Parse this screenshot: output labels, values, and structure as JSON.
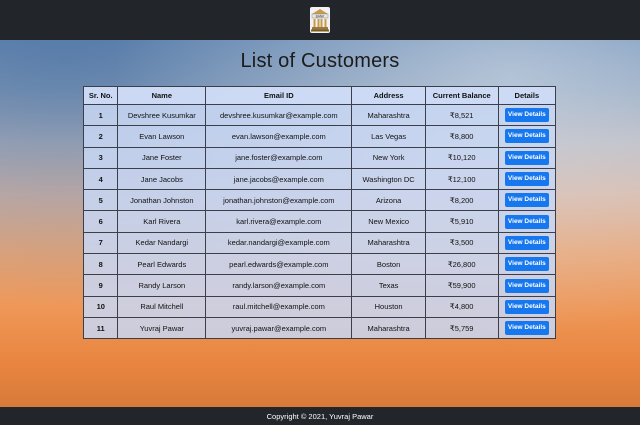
{
  "header": {
    "logo_text": "BANK"
  },
  "page": {
    "title": "List of Customers"
  },
  "table": {
    "headers": [
      "Sr. No.",
      "Name",
      "Email ID",
      "Address",
      "Current Balance",
      "Details"
    ],
    "button_label": "View Details",
    "rows": [
      {
        "sr": "1",
        "name": "Devshree Kusumkar",
        "email": "devshree.kusumkar@example.com",
        "address": "Maharashtra",
        "balance": "₹8,521"
      },
      {
        "sr": "2",
        "name": "Evan Lawson",
        "email": "evan.lawson@example.com",
        "address": "Las Vegas",
        "balance": "₹8,800"
      },
      {
        "sr": "3",
        "name": "Jane Foster",
        "email": "jane.foster@example.com",
        "address": "New York",
        "balance": "₹10,120"
      },
      {
        "sr": "4",
        "name": "Jane Jacobs",
        "email": "jane.jacobs@example.com",
        "address": "Washington DC",
        "balance": "₹12,100"
      },
      {
        "sr": "5",
        "name": "Jonathan Johnston",
        "email": "jonathan.johnston@example.com",
        "address": "Arizona",
        "balance": "₹8,200"
      },
      {
        "sr": "6",
        "name": "Karl Rivera",
        "email": "karl.rivera@example.com",
        "address": "New Mexico",
        "balance": "₹5,910"
      },
      {
        "sr": "7",
        "name": "Kedar Nandargi",
        "email": "kedar.nandargi@example.com",
        "address": "Maharashtra",
        "balance": "₹3,500"
      },
      {
        "sr": "8",
        "name": "Pearl Edwards",
        "email": "pearl.edwards@example.com",
        "address": "Boston",
        "balance": "₹26,800"
      },
      {
        "sr": "9",
        "name": "Randy Larson",
        "email": "randy.larson@example.com",
        "address": "Texas",
        "balance": "₹59,900"
      },
      {
        "sr": "10",
        "name": "Raul Mitchell",
        "email": "raul.mitchell@example.com",
        "address": "Houston",
        "balance": "₹4,800"
      },
      {
        "sr": "11",
        "name": "Yuvraj Pawar",
        "email": "yuvraj.pawar@example.com",
        "address": "Maharashtra",
        "balance": "₹5,759"
      }
    ]
  },
  "footer": {
    "copyright": "Copyright © 2021, Yuvraj Pawar"
  },
  "colors": {
    "navbar": "#22252a",
    "button": "#1677ee",
    "accent": "#1677ee"
  },
  "icons": {
    "logo": "bank-building-icon"
  }
}
